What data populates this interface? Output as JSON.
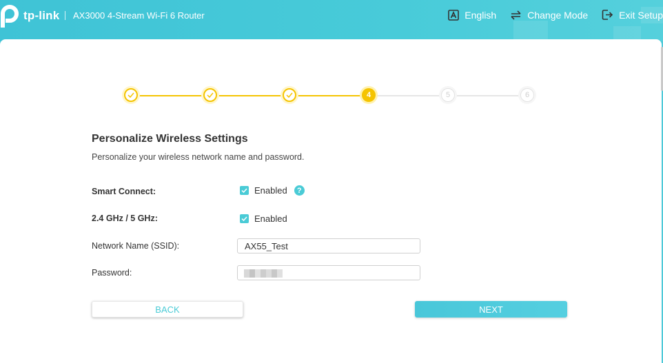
{
  "header": {
    "brand": "tp-link",
    "model": "AX3000 4-Stream Wi-Fi 6 Router",
    "actions": {
      "language": "English",
      "change_mode": "Change Mode",
      "exit_setup": "Exit Setup"
    }
  },
  "stepper": {
    "steps": [
      {
        "label": "",
        "state": "done"
      },
      {
        "label": "",
        "state": "done"
      },
      {
        "label": "",
        "state": "done"
      },
      {
        "label": "4",
        "state": "current"
      },
      {
        "label": "5",
        "state": "future"
      },
      {
        "label": "6",
        "state": "future"
      }
    ]
  },
  "section": {
    "title": "Personalize Wireless Settings",
    "subtitle": "Personalize your wireless network name and password."
  },
  "form": {
    "smart_connect": {
      "label": "Smart Connect:",
      "value": "Enabled",
      "checked": true
    },
    "band": {
      "label": "2.4 GHz / 5 GHz:",
      "value": "Enabled",
      "checked": true
    },
    "ssid": {
      "label": "Network Name (SSID):",
      "value": "AX55_Test"
    },
    "password": {
      "label": "Password:",
      "value": ""
    }
  },
  "buttons": {
    "back": "BACK",
    "next": "NEXT"
  },
  "colors": {
    "accent": "#4acbd6",
    "step_active": "#f5c400",
    "header_bg": "#45c8d8"
  }
}
